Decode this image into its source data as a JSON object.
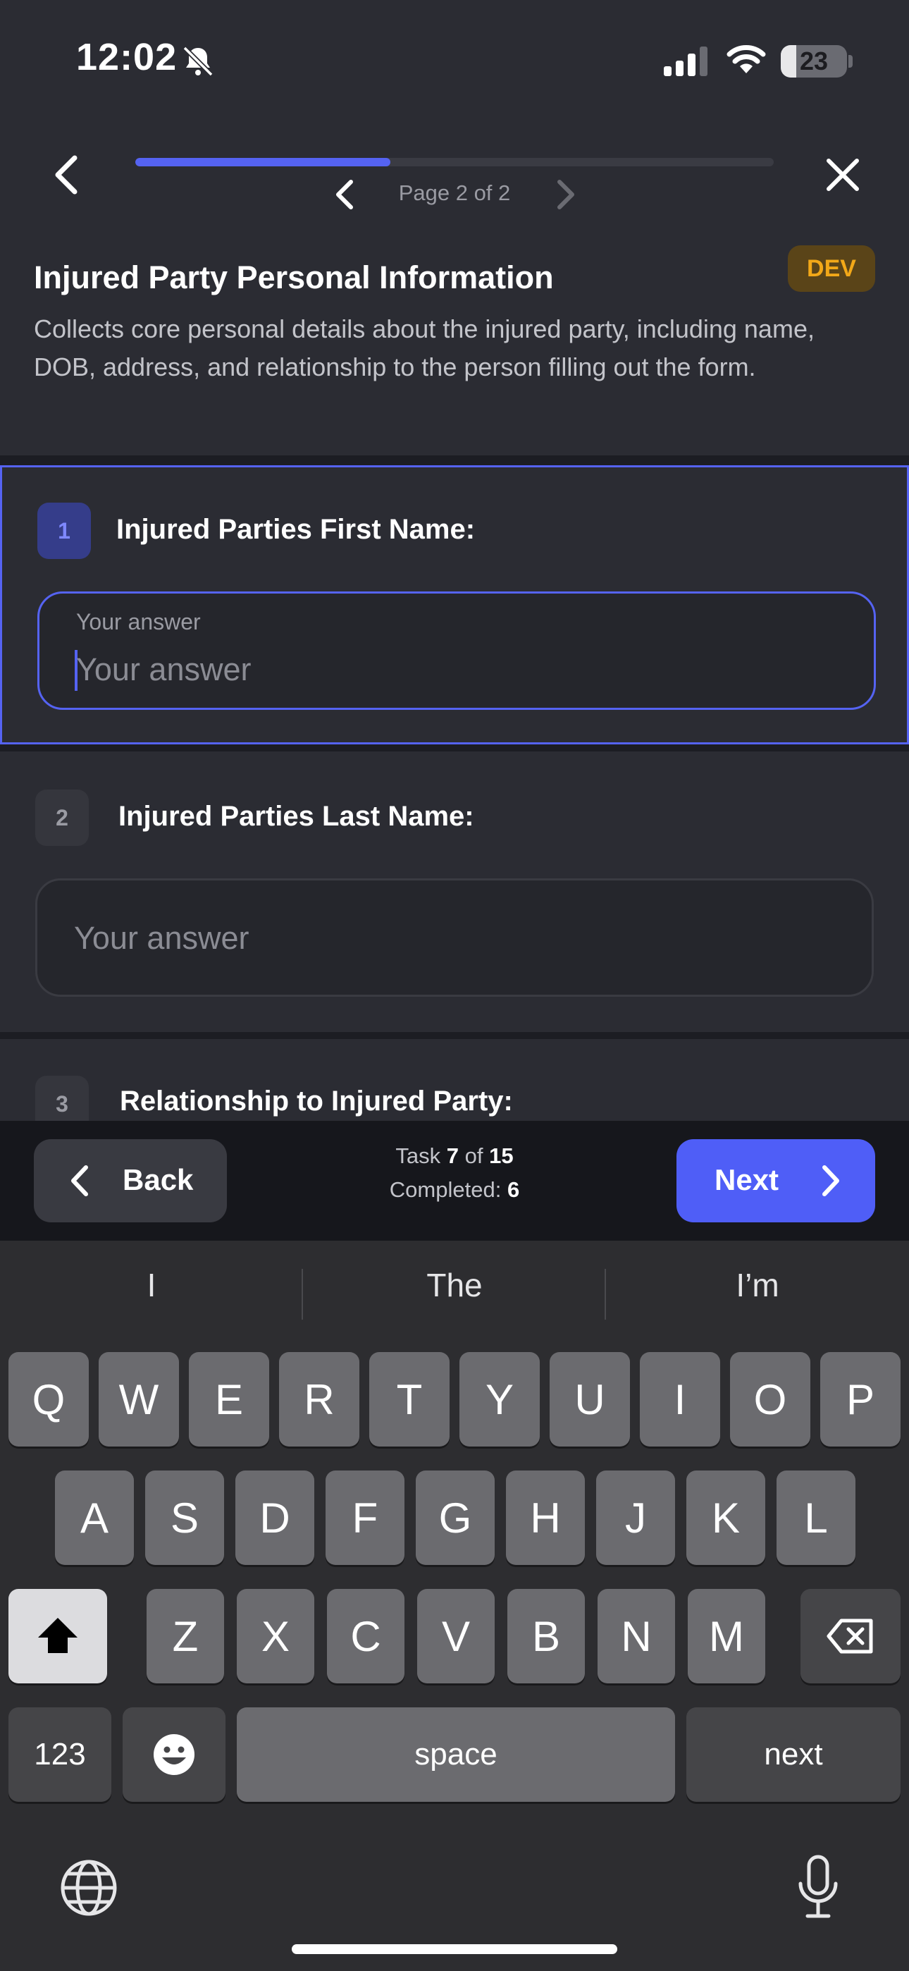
{
  "status_bar": {
    "time": "12:02",
    "battery_level": "23",
    "battery_fraction": 0.23
  },
  "header": {
    "progress_fraction": 0.4,
    "page_label": "Page 2 of 2",
    "dev_badge": "DEV"
  },
  "section": {
    "title": "Injured Party Personal Information",
    "description": "Collects core personal details about the injured party, including name, DOB, address, and relationship to the person filling out the form."
  },
  "questions": [
    {
      "number": "1",
      "label": "Injured Parties First Name:",
      "float_label": "Your answer",
      "placeholder": "Your answer",
      "active": true
    },
    {
      "number": "2",
      "label": "Injured Parties Last Name:",
      "placeholder": "Your answer",
      "active": false
    },
    {
      "number": "3",
      "label": "Relationship to Injured Party:",
      "active": false
    }
  ],
  "action_bar": {
    "back_label": "Back",
    "next_label": "Next",
    "task_prefix": "Task",
    "task_current": "7",
    "task_of": "of",
    "task_total": "15",
    "completed_label": "Completed:",
    "completed_count": "6"
  },
  "keyboard": {
    "suggestions": [
      "I",
      "The",
      "I’m"
    ],
    "row1": [
      "Q",
      "W",
      "E",
      "R",
      "T",
      "Y",
      "U",
      "I",
      "O",
      "P"
    ],
    "row2": [
      "A",
      "S",
      "D",
      "F",
      "G",
      "H",
      "J",
      "K",
      "L"
    ],
    "row3": [
      "Z",
      "X",
      "C",
      "V",
      "B",
      "N",
      "M"
    ],
    "numbers_key": "123",
    "space_key": "space",
    "return_key": "next"
  },
  "colors": {
    "accent": "#4f5ef7",
    "background": "#2b2c33",
    "dev_badge_text": "#f2a818"
  },
  "icons": [
    "bell-slash-icon",
    "signal-icon",
    "wifi-icon",
    "battery-icon",
    "chevron-left-icon",
    "close-icon",
    "chevron-right-icon",
    "shift-icon",
    "backspace-icon",
    "emoji-icon",
    "globe-icon",
    "microphone-icon"
  ]
}
